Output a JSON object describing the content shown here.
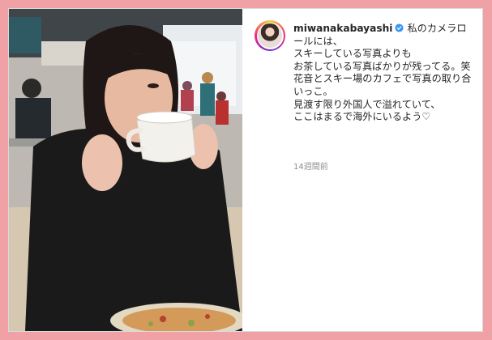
{
  "post": {
    "username": "miwanakabayashi",
    "caption": "私のカメラロールには、\nスキーしている写真よりも\nお茶している写真ばかりが残ってる。笑\n花音とスキー場のカフェで写真の取り合いっこ。\n見渡す限り外国人で溢れていて、\nここはまるで海外にいるよう♡",
    "timestamp": "14週間前"
  },
  "icons": {
    "verified": "verified-badge-icon",
    "avatar": "profile-avatar"
  },
  "colors": {
    "frame": "#f0a1a6",
    "verified": "#3897f0",
    "text": "#262626",
    "muted": "#8e8e8e"
  }
}
